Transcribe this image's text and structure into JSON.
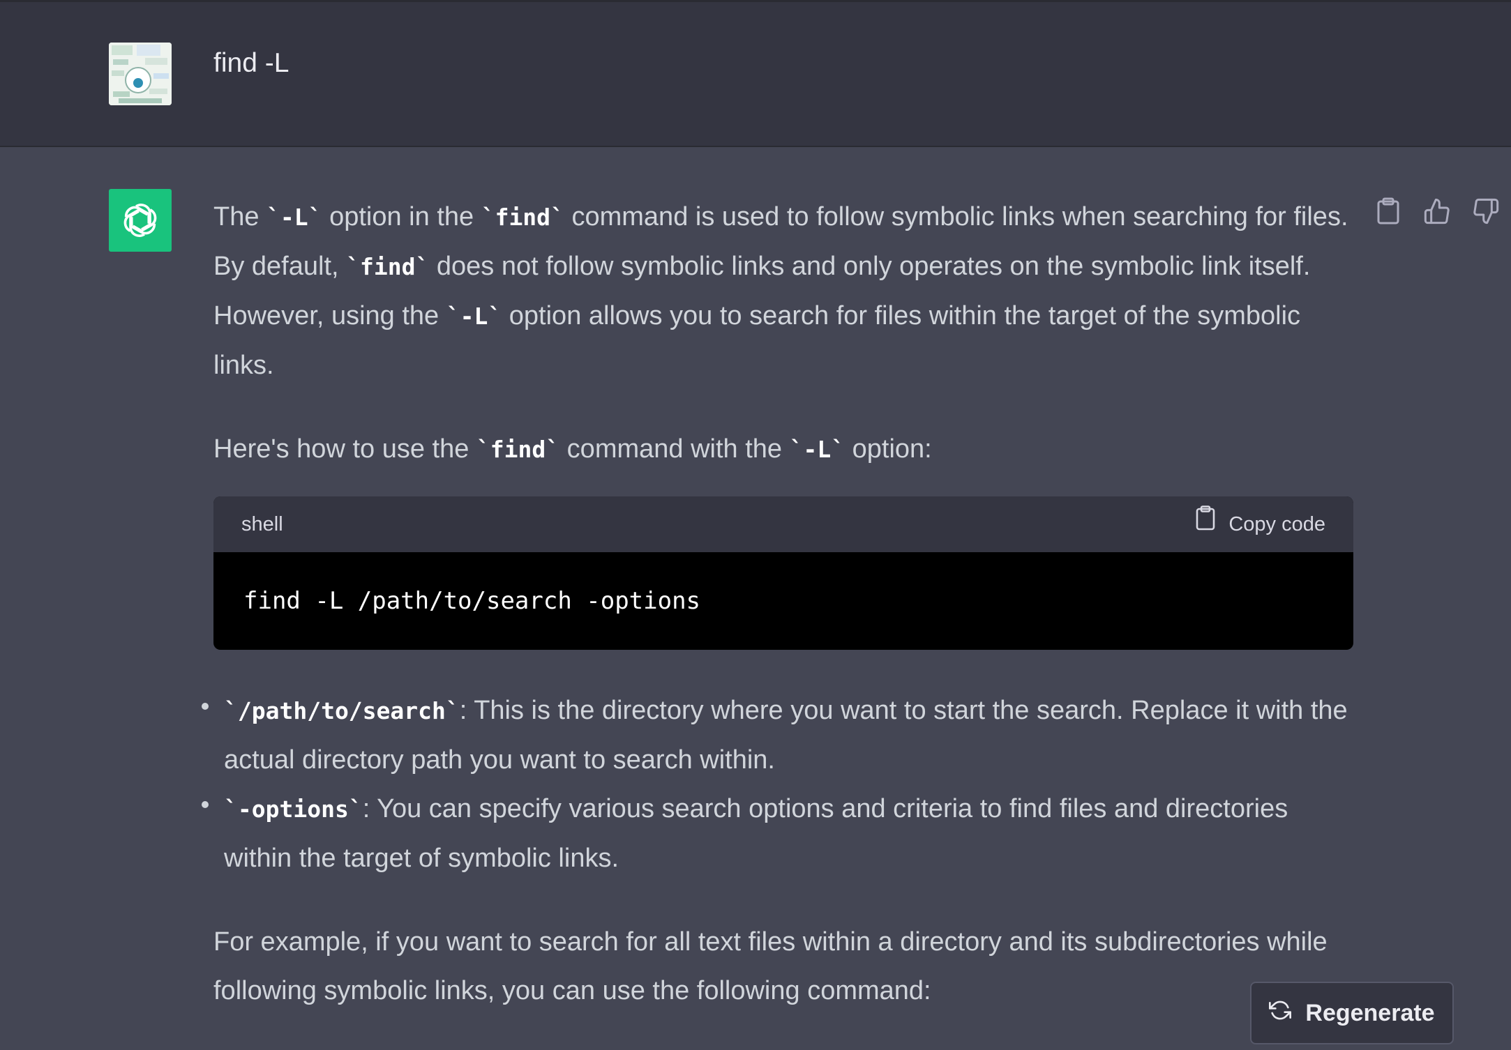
{
  "user_message": {
    "text": "find -L"
  },
  "assistant": {
    "paragraph1": {
      "t1": "The ",
      "c1": "`-L`",
      "t2": " option in the ",
      "c2": "`find`",
      "t3": " command is used to follow symbolic links when searching for files. By default, ",
      "c3": "`find`",
      "t4": " does not follow symbolic links and only operates on the symbolic link itself. However, using the ",
      "c4": "`-L`",
      "t5": " option allows you to search for files within the target of the symbolic links."
    },
    "paragraph2": {
      "t1": "Here's how to use the ",
      "c1": "`find`",
      "t2": " command with the ",
      "c2": "`-L`",
      "t3": " option:"
    },
    "code_block": {
      "language": "shell",
      "copy_label": "Copy code",
      "code": "find -L /path/to/search -options"
    },
    "bullets": [
      {
        "code": "`/path/to/search`",
        "text": ": This is the directory where you want to start the search. Replace it with the actual directory path you want to search within."
      },
      {
        "code": "`-options`",
        "text": ": You can specify various search options and criteria to find files and directories within the target of symbolic links."
      }
    ],
    "paragraph3": "For example, if you want to search for all text files within a directory and its subdirectories while following symbolic links, you can use the following command:"
  },
  "actions": {
    "copy_icon": "clipboard-icon",
    "like_icon": "thumbs-up-icon",
    "dislike_icon": "thumbs-down-icon"
  },
  "regenerate_label": "Regenerate",
  "colors": {
    "accent": "#19c37d",
    "background": "#444654",
    "user_row": "#343541"
  }
}
